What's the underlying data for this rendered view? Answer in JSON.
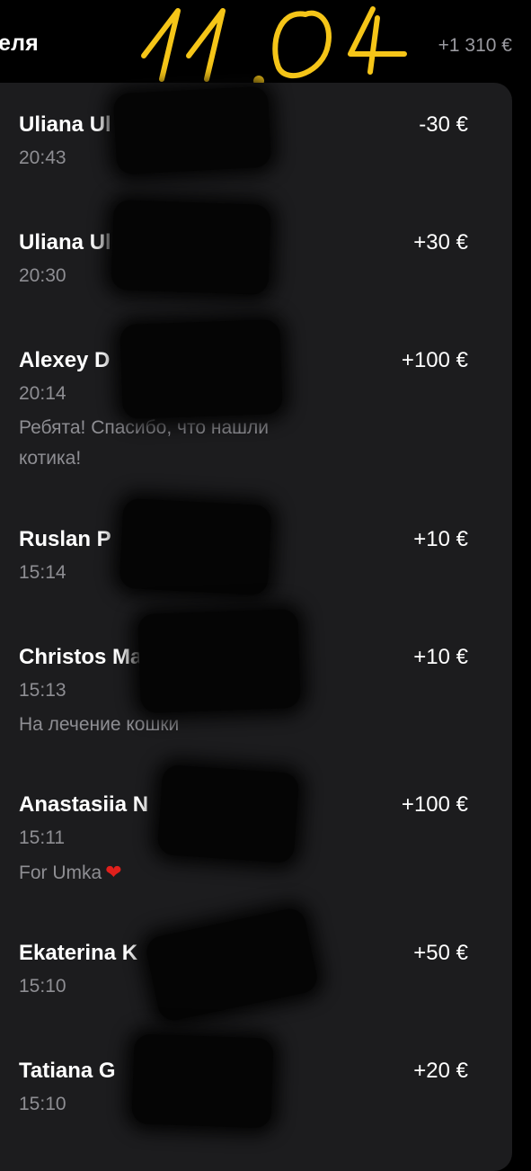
{
  "header": {
    "title": "еля",
    "total": "+1 310 €",
    "handwritten_date": "11.04",
    "handwritten_color": "#f5c518"
  },
  "transactions": [
    {
      "name": "Uliana Ul",
      "amount": "-30 €",
      "time": "20:43",
      "comment": ""
    },
    {
      "name": "Uliana Ul",
      "amount": "+30 €",
      "time": "20:30",
      "comment": ""
    },
    {
      "name": "Alexey D",
      "amount": "+100 €",
      "time": "20:14",
      "comment": "Ребята! Спасибо, что нашли котика!"
    },
    {
      "name": "Ruslan P",
      "amount": "+10 €",
      "time": "15:14",
      "comment": ""
    },
    {
      "name": "Christos Ma",
      "amount": "+10 €",
      "time": "15:13",
      "comment": "На лечение кошки"
    },
    {
      "name": "Anastasiia N",
      "amount": "+100 €",
      "time": "15:11",
      "comment": "For Umka"
    },
    {
      "name": "Ekaterina K",
      "amount": "+50 €",
      "time": "15:10",
      "comment": ""
    },
    {
      "name": "Tatiana G",
      "amount": "+20 €",
      "time": "15:10",
      "comment": ""
    }
  ],
  "colors": {
    "background": "#000000",
    "card": "#1c1c1e",
    "secondary_text": "#8e8e93",
    "heart": "#e0201c"
  },
  "icons": {
    "heart": "heart-icon"
  }
}
